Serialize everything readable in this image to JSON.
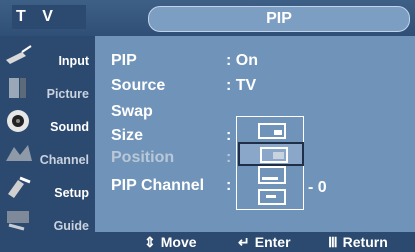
{
  "header": {
    "left_label": "T V",
    "title": "PIP"
  },
  "sidebar": {
    "items": [
      {
        "label": "Input",
        "icon": "input-icon",
        "dim": false
      },
      {
        "label": "Picture",
        "icon": "picture-icon",
        "dim": true
      },
      {
        "label": "Sound",
        "icon": "sound-icon",
        "dim": false
      },
      {
        "label": "Channel",
        "icon": "channel-icon",
        "dim": true
      },
      {
        "label": "Setup",
        "icon": "setup-icon",
        "dim": false
      },
      {
        "label": "Guide",
        "icon": "guide-icon",
        "dim": true
      }
    ]
  },
  "menu": {
    "rows": [
      {
        "label": "PIP",
        "value": ": On"
      },
      {
        "label": "Source",
        "value": ": TV"
      },
      {
        "label": "Swap",
        "value": ""
      },
      {
        "label": "Size",
        "value": ":"
      },
      {
        "label": "Position",
        "value": ":"
      },
      {
        "label": "PIP Channel",
        "value": ":"
      }
    ],
    "pip_channel_tail": "- 0"
  },
  "dropdown": {
    "selected_index": 1,
    "options": [
      "size-option-small",
      "size-option-medium",
      "size-option-large",
      "size-option-double"
    ]
  },
  "footer": {
    "move": "Move",
    "enter": "Enter",
    "return": "Return"
  },
  "colors": {
    "panel": "#6f93b9",
    "sidebar": "#2c4a70",
    "text": "#ffffff"
  }
}
